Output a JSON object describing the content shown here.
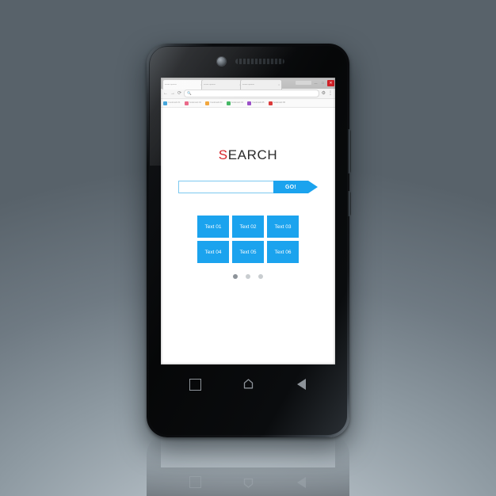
{
  "scene": {
    "background_top": "#4e585f",
    "background_bottom": "#c3ccd2",
    "device": "smartphone-mockup"
  },
  "browser": {
    "tabs": [
      {
        "label": "Lorem ipsum",
        "close": "×",
        "active": true
      },
      {
        "label": "Lorem ipsum",
        "close": "×",
        "active": false
      },
      {
        "label": "Lorem ipsum",
        "close": "×",
        "active": false
      }
    ],
    "window_controls": {
      "minimize": "—",
      "maximize": "□",
      "close": "✕"
    },
    "toolbar": {
      "back": "←",
      "forward": "→",
      "reload": "⟳",
      "search_icon": "🔍",
      "address_value": "",
      "settings": "⚙",
      "menu": "⋮"
    },
    "bookmarks": [
      {
        "label": "bookmark 01",
        "color": "#2e9bd6"
      },
      {
        "label": "bookmark 02",
        "color": "#e85a7d"
      },
      {
        "label": "bookmark 03",
        "color": "#f0a030"
      },
      {
        "label": "bookmark 04",
        "color": "#3fb560"
      },
      {
        "label": "bookmark 05",
        "color": "#9b4fc8"
      },
      {
        "label": "bookmark 06",
        "color": "#dc3b3b"
      }
    ]
  },
  "page": {
    "headline_first": "S",
    "headline_rest": "EARCH",
    "search": {
      "value": "",
      "placeholder": "",
      "go_label": "GO!"
    },
    "tiles": [
      {
        "label": "Text 01"
      },
      {
        "label": "Text 02"
      },
      {
        "label": "Text 03"
      },
      {
        "label": "Text 04"
      },
      {
        "label": "Text 05"
      },
      {
        "label": "Text 06"
      }
    ],
    "pagination": {
      "count": 3,
      "active_index": 0
    },
    "accent_color": "#1ba3ee",
    "accent_border": "#7cc9f0",
    "headline_accent": "#d8252b"
  },
  "android_nav": {
    "recent_apps": "recent-apps",
    "home": "home",
    "back": "back"
  }
}
